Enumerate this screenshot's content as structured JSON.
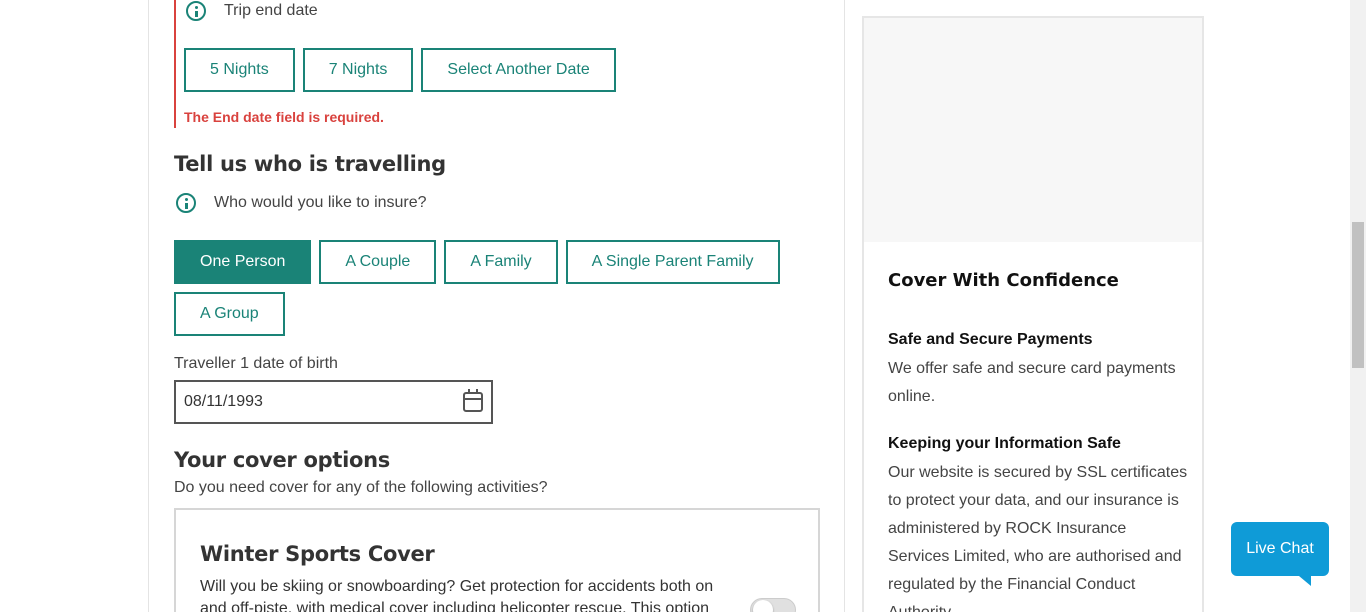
{
  "trip": {
    "end_date_label": "Trip end date",
    "nights_options": [
      "5 Nights",
      "7 Nights",
      "Select Another Date"
    ],
    "error": "The End date field is required."
  },
  "travellers": {
    "title": "Tell us who is travelling",
    "question": "Who would you like to insure?",
    "options": [
      "One Person",
      "A Couple",
      "A Family",
      "A Single Parent Family",
      "A Group"
    ],
    "selected": "One Person",
    "dob_label": "Traveller 1 date of birth",
    "dob_value": "08/11/1993"
  },
  "cover": {
    "title": "Your cover options",
    "subtitle": "Do you need cover for any of the following activities?",
    "winter": {
      "title": "Winter Sports Cover",
      "text": "Will you be skiing or snowboarding? Get protection for accidents both on and off-piste, with medical cover including helicopter rescue. This option"
    }
  },
  "sidebar": {
    "title": "Cover With Confidence",
    "payments_heading": "Safe and Secure Payments",
    "payments_text": "We offer safe and secure card payments online.",
    "info_heading": "Keeping your Information Safe",
    "info_text": "Our website is secured by SSL certificates to protect your data, and our insurance is administered by ROCK Insurance Services Limited, who are authorised and regulated by the Financial Conduct Authority."
  },
  "live_chat": "Live Chat",
  "colors": {
    "accent": "#1a8377",
    "error": "#d9423e",
    "chat": "#0f9bd7"
  }
}
